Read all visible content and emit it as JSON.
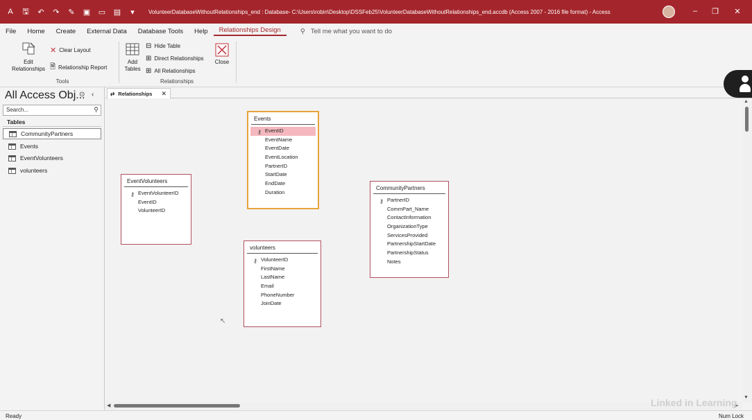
{
  "titlebar": {
    "title": "VolunteerDatabaseWithoutRelationships_end : Database- C:\\Users\\robin\\Desktop\\DSSFeb25\\VolunteerDatabaseWithoutRelationships_end.accdb (Access 2007 - 2016 file format)  -  Access",
    "minimize": "–",
    "restore": "❐",
    "close": "✕"
  },
  "menu": {
    "tabs": [
      "File",
      "Home",
      "Create",
      "External Data",
      "Database Tools",
      "Help",
      "Relationships Design"
    ],
    "active_tab": "Relationships Design",
    "tellme": "Tell me what you want to do"
  },
  "ribbon": {
    "tools": {
      "edit_relationships": "Edit Relationships",
      "clear_layout": "Clear Layout",
      "relationship_report": "Relationship Report",
      "label": "Tools"
    },
    "relationships": {
      "add_tables": "Add Tables",
      "hide_table": "Hide Table",
      "direct_relationships": "Direct Relationships",
      "all_relationships": "All Relationships",
      "close": "Close",
      "label": "Relationships"
    }
  },
  "nav": {
    "title": "All Access Obj...",
    "search_placeholder": "Search...",
    "section": "Tables",
    "items": [
      "CommunityPartners",
      "Events",
      "EventVolunteers",
      "volunteers"
    ],
    "selected": "CommunityPartners"
  },
  "doc_tab": {
    "label": "Relationships"
  },
  "tables": {
    "events": {
      "name": "Events",
      "key": "EventID",
      "fields": [
        "EventName",
        "EventDate",
        "EventLocation",
        "PartnerID",
        "StartDate",
        "EndDate",
        "Duration"
      ]
    },
    "eventvolunteers": {
      "name": "EventVolunteers",
      "key": "EventVolunteerID",
      "fields": [
        "EventID",
        "VolunteerID"
      ]
    },
    "communitypartners": {
      "name": "CommunityPartners",
      "key": "PartnerID",
      "fields": [
        "CommPart_Name",
        "ContactInformation",
        "OrganizationType",
        "ServicesProvided",
        "PartnershipStartDate",
        "PartnershipStatus",
        "Notes"
      ]
    },
    "volunteers": {
      "name": "volunteers",
      "key": "VolunteerID",
      "fields": [
        "FirstName",
        "LastName",
        "Email",
        "PhoneNumber",
        "JoinDate"
      ]
    }
  },
  "status": {
    "left": "Ready",
    "right": "Num Lock"
  },
  "watermark": "Linked in Learning",
  "colors": {
    "title_bar": "#a4262c",
    "selection_border": "#e8a33a",
    "key_highlight": "#f4b8be"
  }
}
